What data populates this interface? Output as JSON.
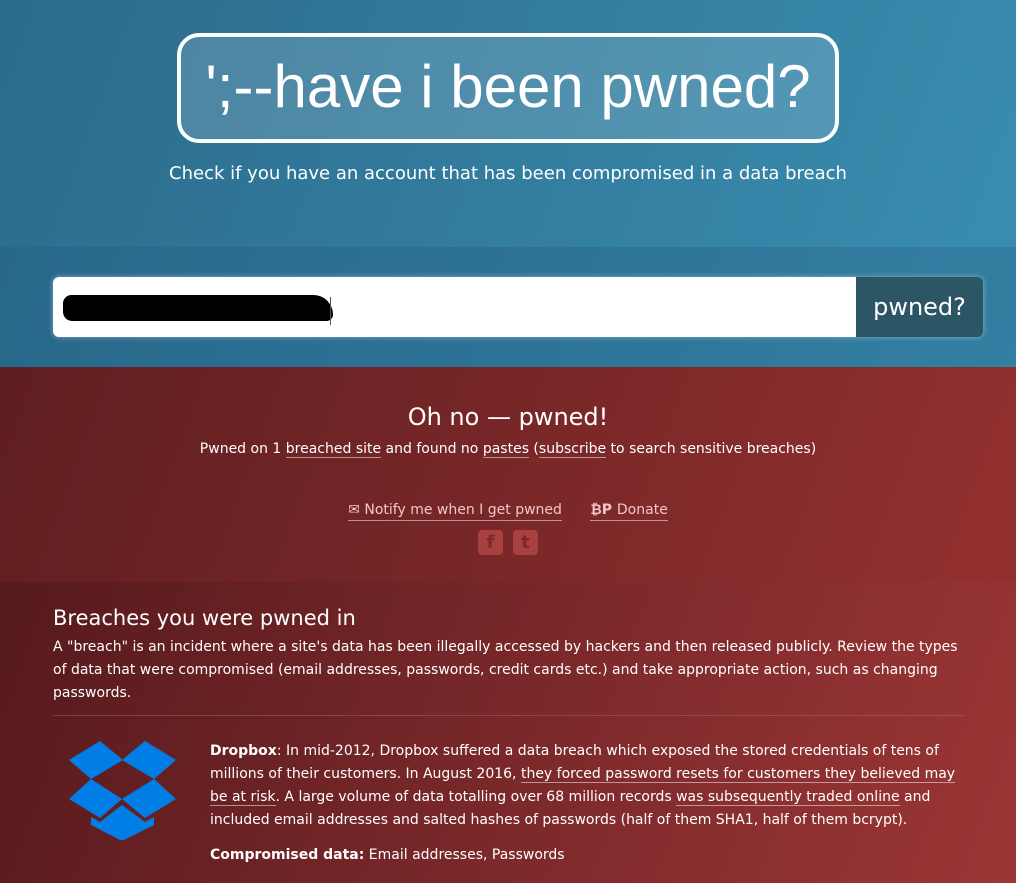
{
  "header": {
    "logo": "';--have i been pwned?",
    "tagline": "Check if you have an account that has been compromised in a data breach"
  },
  "search": {
    "value": "",
    "button": "pwned?"
  },
  "result": {
    "title": "Oh no — pwned!",
    "s1": "Pwned on 1 ",
    "link1": "breached site",
    "s2": " and found no ",
    "link2": "pastes",
    "s3": " (",
    "link3": "subscribe",
    "s4": " to search sensitive breaches)",
    "notify": "Notify me when I get pwned",
    "donate": "Donate"
  },
  "breaches": {
    "title": "Breaches you were pwned in",
    "description": "A \"breach\" is an incident where a site's data has been illegally accessed by hackers and then released publicly. Review the types of data that were compromised (email addresses, passwords, credit cards etc.) and take appropriate action, such as changing passwords.",
    "items": [
      {
        "name": "Dropbox",
        "t1": ": In mid-2012, Dropbox suffered a data breach which exposed the stored credentials of tens of millions of their customers. In August 2016, ",
        "l1": "they forced password resets for customers they believed may be at risk",
        "t2": ". A large volume of data totalling over 68 million records ",
        "l2": "was subsequently traded online",
        "t3": " and included email addresses and salted hashes of passwords (half of them SHA1, half of them bcrypt).",
        "comp_label": "Compromised data:",
        "comp": " Email addresses, Passwords",
        "logo_color": "#007ee5"
      }
    ]
  }
}
